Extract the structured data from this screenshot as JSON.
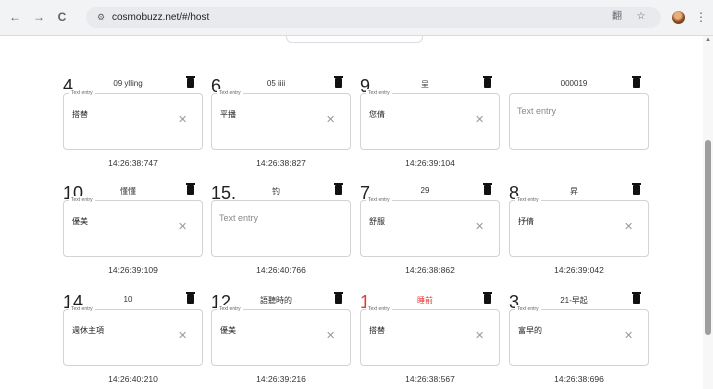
{
  "browser": {
    "url": "cosmobuzz.net/#/host",
    "back_icon": "←",
    "forward_icon": "→",
    "reload_icon": "C",
    "site_icon": "⚙",
    "translate_icon": "翻",
    "star_icon": "☆",
    "menu_icon": "⋮"
  },
  "entries": [
    {
      "number": "4.",
      "name": "09 ylling",
      "value": "搭替",
      "placeholder": "",
      "label": "Text entry",
      "time": "14:26:38:747",
      "red": false
    },
    {
      "number": "6.",
      "name": "05 iiii",
      "value": "平播",
      "placeholder": "",
      "label": "Text entry",
      "time": "14:26:38:827",
      "red": false
    },
    {
      "number": "9.",
      "name": "呈",
      "value": "您倩",
      "placeholder": "",
      "label": "Text entry",
      "time": "14:26:39:104",
      "red": false
    },
    {
      "number": "",
      "name": "000019",
      "value": "",
      "placeholder": "Text entry",
      "label": "",
      "time": "",
      "red": false
    },
    {
      "number": "10.",
      "name": "懂懂",
      "value": "優美",
      "placeholder": "",
      "label": "Text entry",
      "time": "14:26:39:109",
      "red": false
    },
    {
      "number": "15.",
      "name": "钓",
      "value": "",
      "placeholder": "Text entry",
      "label": "",
      "time": "14:26:40:766",
      "red": false
    },
    {
      "number": "7.",
      "name": "29",
      "value": "舒服",
      "placeholder": "",
      "label": "Text entry",
      "time": "14:26:38:862",
      "red": false
    },
    {
      "number": "8.",
      "name": "昇",
      "value": "抒倩",
      "placeholder": "",
      "label": "Text entry",
      "time": "14:26:39:042",
      "red": false
    },
    {
      "number": "14.",
      "name": "10",
      "value": "週休主項",
      "placeholder": "",
      "label": "Text entry",
      "time": "14:26:40:210",
      "red": false
    },
    {
      "number": "12.",
      "name": "語聽時的",
      "value": "優美",
      "placeholder": "",
      "label": "Text entry",
      "time": "14:26:39:216",
      "red": false
    },
    {
      "number": "1.",
      "name": "睡前",
      "value": "搭替",
      "placeholder": "",
      "label": "Text entry",
      "time": "14:26:38:567",
      "red": true
    },
    {
      "number": "3.",
      "name": "21-早起",
      "value": "富早的",
      "placeholder": "",
      "label": "Text entry",
      "time": "14:26:38:696",
      "red": false
    }
  ]
}
